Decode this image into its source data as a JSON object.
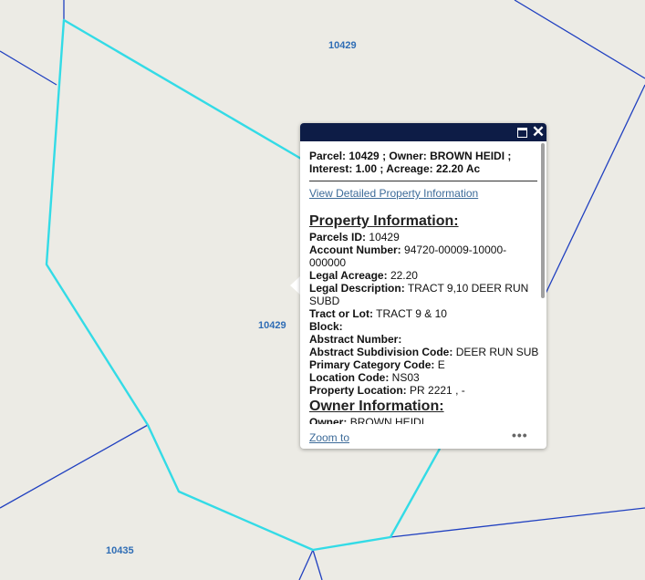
{
  "map": {
    "parcel_labels": [
      "10429",
      "10429",
      "10435"
    ]
  },
  "colors": {
    "map_background": "#ecebe5",
    "parcel_line": "#2040c0",
    "selected_parcel": "#33dbe6",
    "label_text": "#2f6db5",
    "popup_header": "#0d1c46",
    "link": "#3d6b99"
  },
  "popup": {
    "title": "Parcel: 10429 ; Owner: BROWN HEIDI ; Interest: 1.00 ; Acreage: 22.20 Ac",
    "detail_link": "View Detailed Property Information",
    "property_heading": "Property Information:",
    "fields": [
      {
        "label": "Parcels ID:",
        "value": "10429"
      },
      {
        "label": "Account Number:",
        "value": "94720-00009-10000-000000"
      },
      {
        "label": "Legal Acreage:",
        "value": "22.20"
      },
      {
        "label": "Legal Description:",
        "value": "TRACT 9,10 DEER RUN SUBD"
      },
      {
        "label": "Tract or Lot:",
        "value": "TRACT 9 & 10"
      },
      {
        "label": "Block:",
        "value": ""
      },
      {
        "label": "Abstract Number:",
        "value": ""
      },
      {
        "label": "Abstract Subdivision Code:",
        "value": "DEER RUN SUB"
      },
      {
        "label": "Primary Category Code:",
        "value": "E"
      },
      {
        "label": "Location Code:",
        "value": "NS03"
      },
      {
        "label": "Property Location:",
        "value": "PR 2221 , -"
      }
    ],
    "owner_heading": "Owner Information:",
    "owner_fields": [
      {
        "label": "Owner:",
        "value": "BROWN HEIDI"
      }
    ],
    "zoom_label": "Zoom to",
    "more_label": "•••",
    "maximize_icon": "maximize-icon",
    "close_icon": "close-icon"
  }
}
